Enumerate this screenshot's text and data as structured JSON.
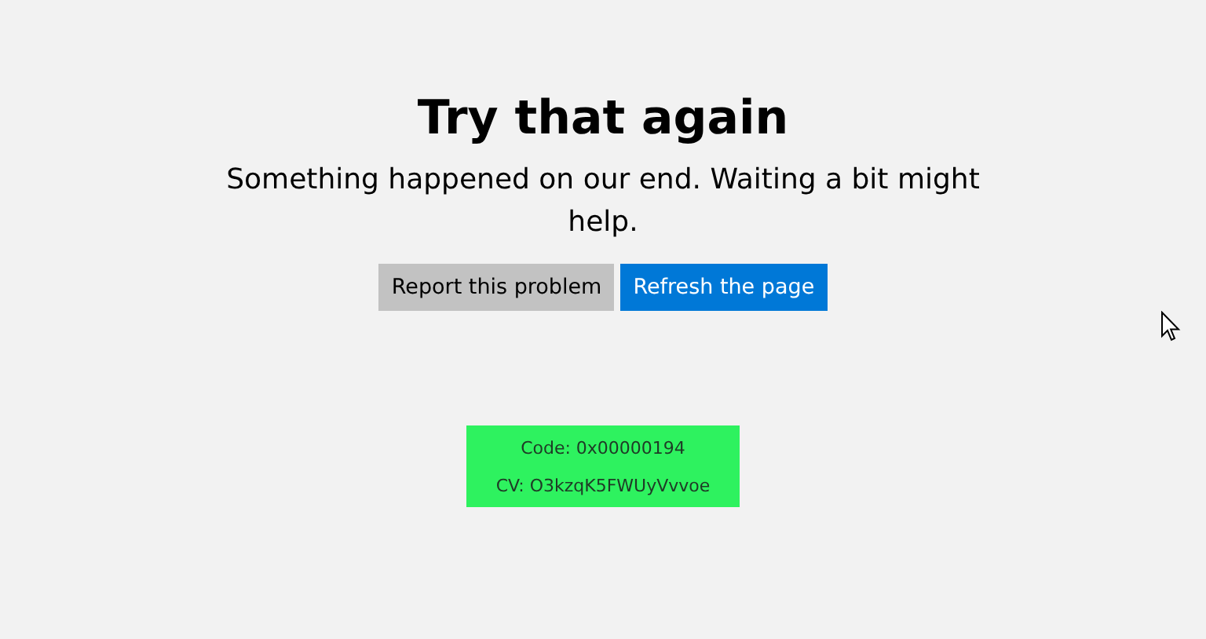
{
  "title": "Try that again",
  "message": "Something happened on our end. Waiting a bit might help.",
  "buttons": [
    {
      "label": "Report this problem",
      "kind": "secondary"
    },
    {
      "label": "Refresh the page",
      "kind": "primary"
    }
  ],
  "error_info": {
    "code": "Code: 0x00000194",
    "cv": "CV: O3kzqK5FWUyVvvoe"
  }
}
